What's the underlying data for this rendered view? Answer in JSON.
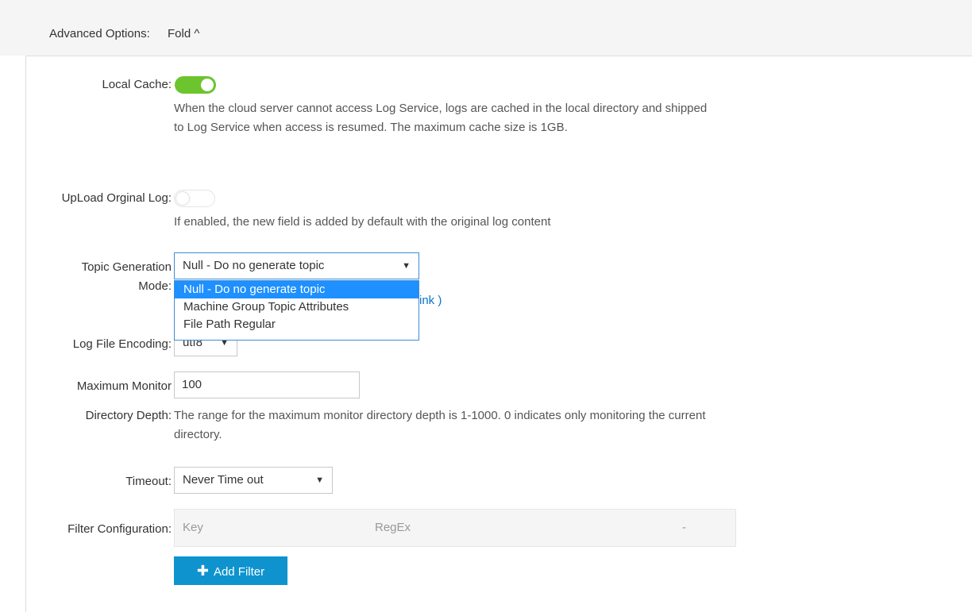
{
  "advanced_options": {
    "label": "Advanced Options:",
    "toggle": "Fold ^"
  },
  "local_cache": {
    "label": "Local Cache:",
    "enabled": true,
    "help": "When the cloud server cannot access Log Service, logs are cached in the local directory and shipped to Log Service when access is resumed. The maximum cache size is 1GB."
  },
  "upload_original_log": {
    "label": "UpLoad Orginal Log:",
    "enabled": false,
    "help": "If enabled, the new field is added by default with the original log content"
  },
  "topic_generation": {
    "label_line1": "Topic Generation",
    "label_line2": "Mode:",
    "selected": "Null - Do no generate topic",
    "options": [
      "Null - Do no generate topic",
      "Machine Group Topic Attributes",
      "File Path Regular"
    ],
    "link_fragment": "ink )"
  },
  "log_file_encoding": {
    "label": "Log File Encoding:",
    "value": "utf8"
  },
  "max_monitor_depth": {
    "label_line1": "Maximum Monitor",
    "label_line2": "Directory Depth:",
    "value": "100",
    "help": "The range for the maximum monitor directory depth is 1-1000. 0 indicates only monitoring the current directory."
  },
  "timeout": {
    "label": "Timeout:",
    "selected": "Never Time out"
  },
  "filter_configuration": {
    "label": "Filter Configuration:",
    "columns": [
      "Key",
      "RegEx",
      "-"
    ],
    "add_button": "Add Filter"
  },
  "colors": {
    "accent": "#0e93cf",
    "switch_on": "#6cc52e",
    "option_selected": "#1e90ff"
  }
}
